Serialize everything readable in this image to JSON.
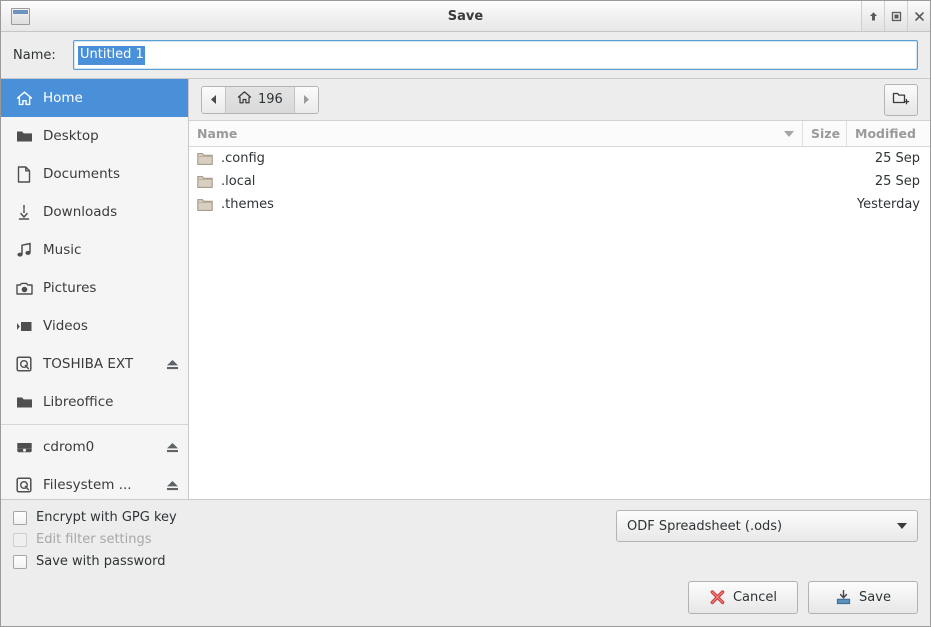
{
  "window": {
    "title": "Save",
    "app_icon": "window-icon",
    "controls": [
      {
        "name": "shade-button",
        "icon": "arrow-up-icon"
      },
      {
        "name": "maximize-button",
        "icon": "square-icon"
      },
      {
        "name": "close-button",
        "icon": "close-x-icon"
      }
    ]
  },
  "name_row": {
    "label": "Name:",
    "value": "Untitled 1",
    "selected": true
  },
  "sidebar": {
    "items": [
      {
        "label": "Home",
        "icon": "home-icon",
        "selected": true,
        "eject": false
      },
      {
        "label": "Desktop",
        "icon": "folder-icon",
        "selected": false,
        "eject": false
      },
      {
        "label": "Documents",
        "icon": "document-icon",
        "selected": false,
        "eject": false
      },
      {
        "label": "Downloads",
        "icon": "download-icon",
        "selected": false,
        "eject": false
      },
      {
        "label": "Music",
        "icon": "music-note-icon",
        "selected": false,
        "eject": false
      },
      {
        "label": "Pictures",
        "icon": "camera-icon",
        "selected": false,
        "eject": false
      },
      {
        "label": "Videos",
        "icon": "video-camera-icon",
        "selected": false,
        "eject": false
      },
      {
        "label": "TOSHIBA EXT",
        "icon": "harddisk-icon",
        "selected": false,
        "eject": true
      },
      {
        "label": "Libreoffice",
        "icon": "folder-icon",
        "selected": false,
        "eject": false
      }
    ],
    "devices": [
      {
        "label": "cdrom0",
        "icon": "cdrom-icon",
        "selected": false,
        "eject": true
      },
      {
        "label": "Filesystem ...",
        "icon": "harddisk-icon",
        "selected": false,
        "eject": true
      }
    ]
  },
  "pathbar": {
    "back_icon": "triangle-left-icon",
    "forward_icon": "triangle-right-icon",
    "current": {
      "icon": "home-icon",
      "label": "196"
    },
    "new_folder_icon": "new-folder-icon"
  },
  "filelist": {
    "columns": [
      {
        "key": "name",
        "label": "Name",
        "sort": "descending"
      },
      {
        "key": "size",
        "label": "Size"
      },
      {
        "key": "modified",
        "label": "Modified"
      }
    ],
    "rows": [
      {
        "icon": "folder-icon",
        "name": ".config",
        "size": "",
        "modified": "25 Sep"
      },
      {
        "icon": "folder-icon",
        "name": ".local",
        "size": "",
        "modified": "25 Sep"
      },
      {
        "icon": "folder-icon",
        "name": ".themes",
        "size": "",
        "modified": "Yesterday"
      }
    ]
  },
  "options": {
    "checkboxes": [
      {
        "label": "Encrypt with GPG key",
        "checked": false,
        "disabled": false
      },
      {
        "label": "Edit filter settings",
        "checked": false,
        "disabled": true
      },
      {
        "label": "Save with password",
        "checked": false,
        "disabled": false
      }
    ],
    "filetype": {
      "value": "ODF Spreadsheet (.ods)",
      "caret_icon": "chevron-down-icon"
    }
  },
  "actions": {
    "cancel": {
      "label": "Cancel",
      "icon": "red-x-icon"
    },
    "save": {
      "label": "Save",
      "icon": "save-disk-icon"
    }
  },
  "colors": {
    "selection_blue": "#4a90d9",
    "window_bg": "#ededed",
    "list_bg": "#ffffff",
    "sidebar_bg": "#f5f5f5",
    "folder_tan": "#d9cfc0",
    "cancel_red": "#d13c3c",
    "save_blue": "#5a8fc0"
  }
}
